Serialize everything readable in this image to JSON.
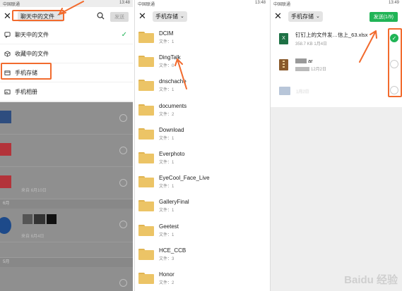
{
  "panel1": {
    "status_left": "中国联通",
    "status_right": "13:48",
    "dropdown_label": "聊天中的文件",
    "send_label": "发送",
    "menu": [
      {
        "label": "聊天中的文件",
        "icon": "chat-icon"
      },
      {
        "label": "收藏中的文件",
        "icon": "cube-icon"
      },
      {
        "label": "手机存储",
        "icon": "phone-storage-icon"
      },
      {
        "label": "手机相册",
        "icon": "photo-icon"
      }
    ],
    "dim_meta": [
      "来自"
    ],
    "dim_dates": [
      "6月10日",
      "6月4日"
    ],
    "dim_section": [
      "6月",
      "5月"
    ]
  },
  "panel2": {
    "status_left": "中国联通",
    "status_right": "13:48",
    "dropdown_label": "手机存储",
    "folders": [
      {
        "name": "DCIM",
        "count": "文件：1"
      },
      {
        "name": "DingTalk",
        "count": "文件：0"
      },
      {
        "name": "dnschache",
        "count": "文件：1"
      },
      {
        "name": "documents",
        "count": "文件：2"
      },
      {
        "name": "Download",
        "count": "文件：1"
      },
      {
        "name": "Everphoto",
        "count": "文件：1"
      },
      {
        "name": "EyeCool_Face_Live",
        "count": "文件：1"
      },
      {
        "name": "GalleryFinal",
        "count": "文件：1"
      },
      {
        "name": "Geetest",
        "count": "文件：1"
      },
      {
        "name": "HCE_CCB",
        "count": "文件：3"
      },
      {
        "name": "Honor",
        "count": "文件：2"
      }
    ]
  },
  "panel3": {
    "status_left": "中国联通",
    "status_right": "13:49",
    "dropdown_label": "手机存储",
    "send_label": "发送(1/9)",
    "files": [
      {
        "title": "钉钉上的文件发…信上_63.xlsx",
        "meta": "358.7 KB  1月4日"
      },
      {
        "title": "ar",
        "meta": "12月2日"
      },
      {
        "title": "",
        "meta": "1月2日"
      }
    ]
  },
  "watermark": "Baidu 经验",
  "colors": {
    "accent_green": "#20b456",
    "highlight_orange": "#f26b2e",
    "folder": "#ecc466"
  }
}
